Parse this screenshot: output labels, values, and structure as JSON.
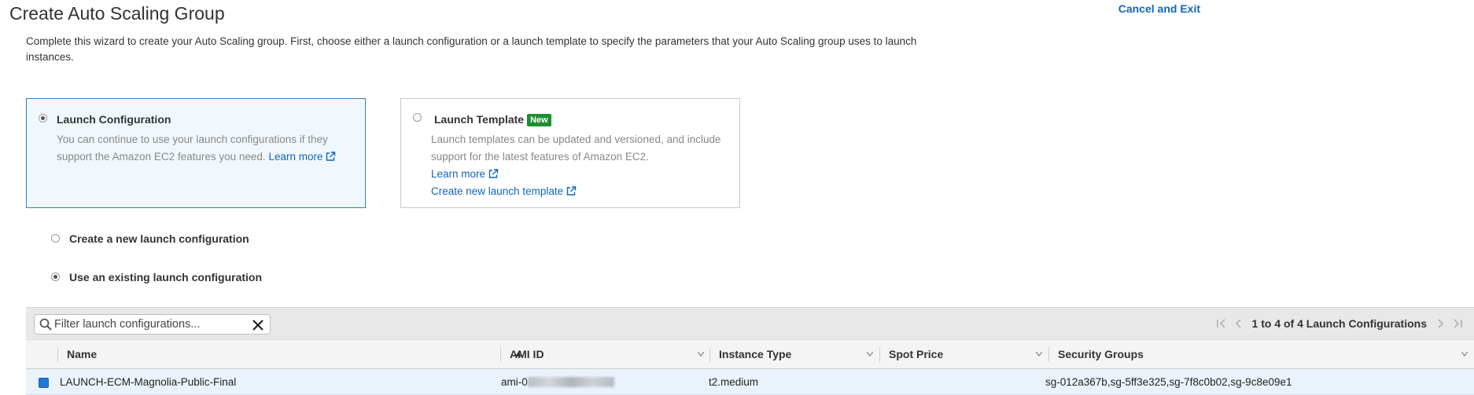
{
  "header": {
    "title": "Create Auto Scaling Group",
    "cancel_label": "Cancel and Exit"
  },
  "intro": "Complete this wizard to create your Auto Scaling group. First, choose either a launch configuration or a launch template to specify the parameters that your Auto Scaling group uses to launch instances.",
  "cards": {
    "launch_configuration": {
      "title": "Launch Configuration",
      "description": "You can continue to use your launch configurations if they support the Amazon EC2 features you need.",
      "learn_more": "Learn more",
      "selected": true
    },
    "launch_template": {
      "title": "Launch Template",
      "badge": "New",
      "description": "Launch templates can be updated and versioned, and include support for the latest features of Amazon EC2.",
      "learn_more": "Learn more",
      "create_link": "Create new launch template",
      "selected": false
    }
  },
  "options": {
    "create_new": {
      "label": "Create a new launch configuration",
      "checked": false
    },
    "use_existing": {
      "label": "Use an existing launch configuration",
      "checked": true
    }
  },
  "table": {
    "filter_placeholder": "Filter launch configurations...",
    "pagination": "1 to 4 of 4 Launch Configurations",
    "columns": [
      "Name",
      "AMI ID",
      "Instance Type",
      "Spot Price",
      "Security Groups"
    ],
    "sorted_column": "Name",
    "rows": [
      {
        "selected": true,
        "name": "LAUNCH-ECM-Magnolia-Public-Final",
        "ami_id_prefix": "ami-0",
        "instance_type": "t2.medium",
        "spot_price": "",
        "security_groups": "sg-012a367b,sg-5ff3e325,sg-7f8c0b02,sg-9c8e09e1"
      }
    ]
  },
  "colors": {
    "link": "#1166bb",
    "selected_border": "#2f7fc8",
    "selected_bg": "#f1f8fd",
    "badge_bg": "#1d8f2f",
    "row_selected_bg": "#eaf3fb",
    "checkbox": "#1f78d1"
  }
}
